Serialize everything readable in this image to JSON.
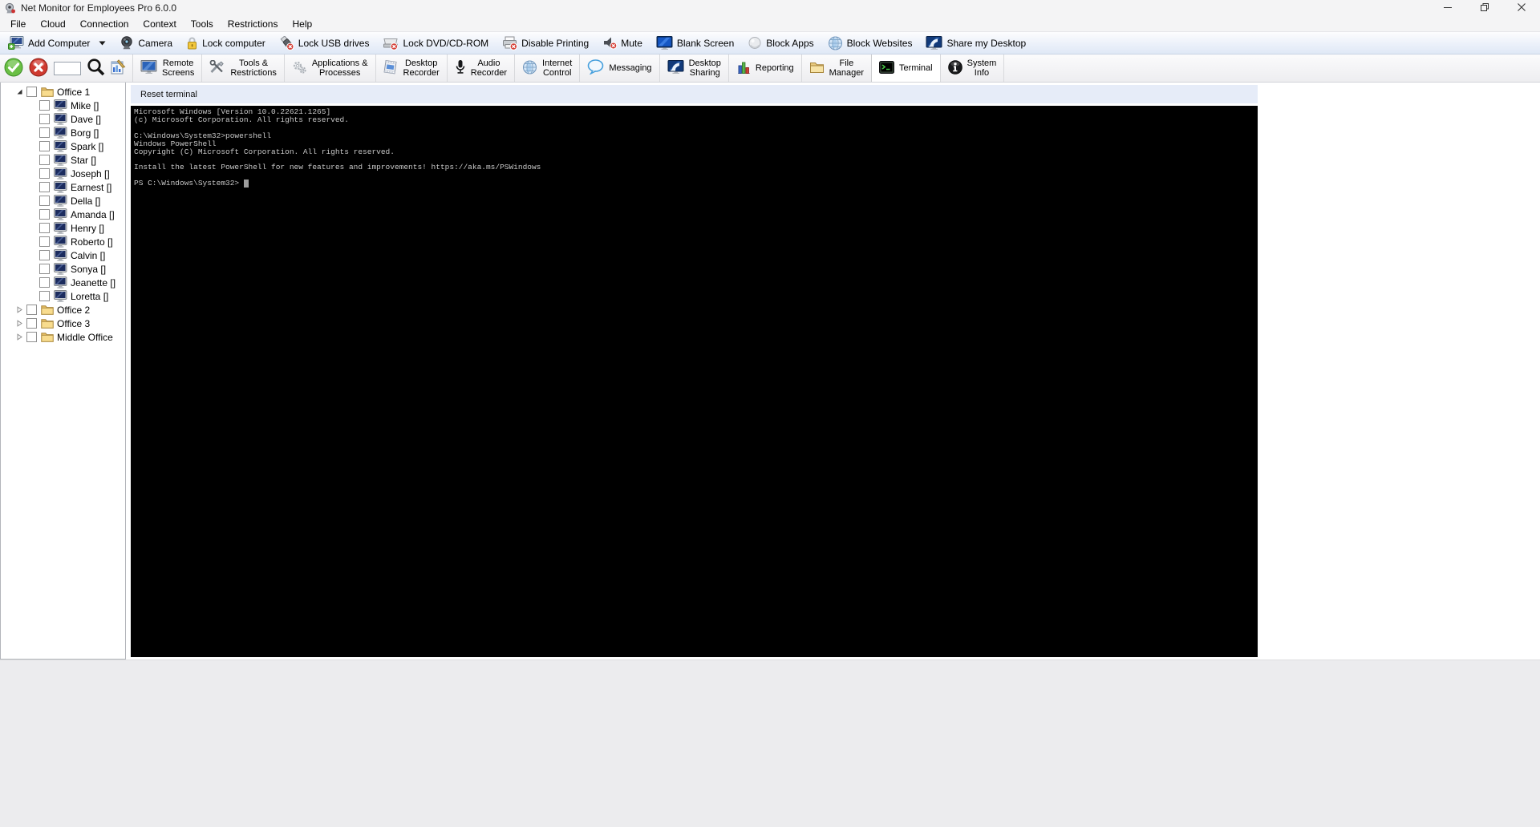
{
  "window": {
    "title": "Net Monitor for Employees Pro 6.0.0",
    "app_icon": "app-icon",
    "controls": [
      {
        "id": "minimize",
        "icon": "minimize-icon"
      },
      {
        "id": "restore",
        "icon": "restore-icon"
      },
      {
        "id": "close",
        "icon": "close-icon"
      }
    ]
  },
  "menu_bar": {
    "items": [
      "File",
      "Cloud",
      "Connection",
      "Context",
      "Tools",
      "Restrictions",
      "Help"
    ]
  },
  "toolbar": {
    "buttons": [
      {
        "id": "add-computer",
        "label": "Add Computer",
        "icon": "add-computer-icon",
        "has_dropdown": true
      },
      {
        "id": "camera",
        "label": "Camera",
        "icon": "camera-icon",
        "has_dropdown": false
      },
      {
        "id": "lock-computer",
        "label": "Lock computer",
        "icon": "lock-computer-icon",
        "has_dropdown": false
      },
      {
        "id": "lock-usb-drives",
        "label": "Lock USB drives",
        "icon": "lock-usb-icon",
        "has_dropdown": false
      },
      {
        "id": "lock-dvd",
        "label": "Lock DVD/CD-ROM",
        "icon": "lock-dvd-icon",
        "has_dropdown": false
      },
      {
        "id": "disable-printing",
        "label": "Disable Printing",
        "icon": "disable-printing-icon",
        "has_dropdown": false
      },
      {
        "id": "mute",
        "label": "Mute",
        "icon": "mute-icon",
        "has_dropdown": false
      },
      {
        "id": "blank-screen",
        "label": "Blank Screen",
        "icon": "blank-screen-icon",
        "has_dropdown": false
      },
      {
        "id": "block-apps",
        "label": "Block Apps",
        "icon": "block-apps-icon",
        "has_dropdown": false
      },
      {
        "id": "block-websites",
        "label": "Block Websites",
        "icon": "block-websites-icon",
        "has_dropdown": false
      },
      {
        "id": "share-my-desktop",
        "label": "Share my Desktop",
        "icon": "share-desktop-icon",
        "has_dropdown": false
      }
    ]
  },
  "action_bar": {
    "connect_button": {
      "id": "connect",
      "icon": "connect-check-icon"
    },
    "disconnect_button": {
      "id": "disconnect",
      "icon": "disconnect-x-icon"
    },
    "search_input": {
      "value": "",
      "placeholder": ""
    },
    "search_button": {
      "id": "search",
      "icon": "search-icon"
    },
    "log_button": {
      "id": "log-viewer",
      "icon": "log-viewer-icon"
    }
  },
  "tab_bar": {
    "tabs": [
      {
        "id": "remote-screens",
        "label": "Remote Screens",
        "icon": "remote-screens-icon",
        "selected": false
      },
      {
        "id": "tools-restrictions",
        "label": "Tools & Restrictions",
        "icon": "tools-restrictions-icon",
        "selected": false
      },
      {
        "id": "applications-processes",
        "label": "Applications & Processes",
        "icon": "applications-processes-icon",
        "selected": false
      },
      {
        "id": "desktop-recorder",
        "label": "Desktop Recorder",
        "icon": "desktop-recorder-icon",
        "selected": false
      },
      {
        "id": "audio-recorder",
        "label": "Audio Recorder",
        "icon": "audio-recorder-icon",
        "selected": false
      },
      {
        "id": "internet-control",
        "label": "Internet Control",
        "icon": "internet-control-icon",
        "selected": false
      },
      {
        "id": "messaging",
        "label": "Messaging",
        "icon": "messaging-icon",
        "selected": false
      },
      {
        "id": "desktop-sharing",
        "label": "Desktop Sharing",
        "icon": "desktop-sharing-icon",
        "selected": false
      },
      {
        "id": "reporting",
        "label": "Reporting",
        "icon": "reporting-icon",
        "selected": false
      },
      {
        "id": "file-manager",
        "label": "File Manager",
        "icon": "file-manager-icon",
        "selected": false
      },
      {
        "id": "terminal",
        "label": "Terminal",
        "icon": "terminal-icon",
        "selected": true
      },
      {
        "id": "system-info",
        "label": "System Info",
        "icon": "system-info-icon",
        "selected": false
      }
    ]
  },
  "sidebar_tree": {
    "groups": [
      {
        "label": "Office 1",
        "expanded": true,
        "checked": false,
        "computers": [
          {
            "name": "Mike",
            "status": "[]",
            "checked": false
          },
          {
            "name": "Dave",
            "status": "[]",
            "checked": false
          },
          {
            "name": "Borg",
            "status": "[]",
            "checked": false
          },
          {
            "name": "Spark",
            "status": "[]",
            "checked": false
          },
          {
            "name": "Star",
            "status": "[]",
            "checked": false
          },
          {
            "name": "Joseph",
            "status": "[]",
            "checked": false
          },
          {
            "name": "Earnest",
            "status": "[]",
            "checked": false
          },
          {
            "name": "Della",
            "status": "[]",
            "checked": false
          },
          {
            "name": "Amanda",
            "status": "[]",
            "checked": false
          },
          {
            "name": "Henry",
            "status": "[]",
            "checked": false
          },
          {
            "name": "Roberto",
            "status": "[]",
            "checked": false
          },
          {
            "name": "Calvin",
            "status": "[]",
            "checked": false
          },
          {
            "name": "Sonya",
            "status": "[]",
            "checked": false
          },
          {
            "name": "Jeanette",
            "status": "[]",
            "checked": false
          },
          {
            "name": "Loretta",
            "status": "[]",
            "checked": false
          }
        ]
      },
      {
        "label": "Office 2",
        "expanded": false,
        "checked": false,
        "computers": []
      },
      {
        "label": "Office 3",
        "expanded": false,
        "checked": false,
        "computers": []
      },
      {
        "label": "Middle Office",
        "expanded": false,
        "checked": false,
        "computers": []
      }
    ]
  },
  "terminal_panel": {
    "reset_button_label": "Reset terminal",
    "output_lines": [
      "Microsoft Windows [Version 10.0.22621.1265]",
      "(c) Microsoft Corporation. All rights reserved.",
      "",
      "C:\\Windows\\System32>powershell",
      "Windows PowerShell",
      "Copyright (C) Microsoft Corporation. All rights reserved.",
      "",
      "Install the latest PowerShell for new features and improvements! https://aka.ms/PSWindows",
      ""
    ],
    "prompt": "PS C:\\Windows\\System32> ",
    "cursor_visible": true
  },
  "colors": {
    "terminal_background": "#000000",
    "terminal_text": "#c8c8c8",
    "connect_green": "#6abf45",
    "disconnect_red": "#cf3a30",
    "folder_yellow": "#f0c75a",
    "toolbar_blue_tint": "#dfe8f6",
    "tab_selected_background": "#ffffff"
  }
}
